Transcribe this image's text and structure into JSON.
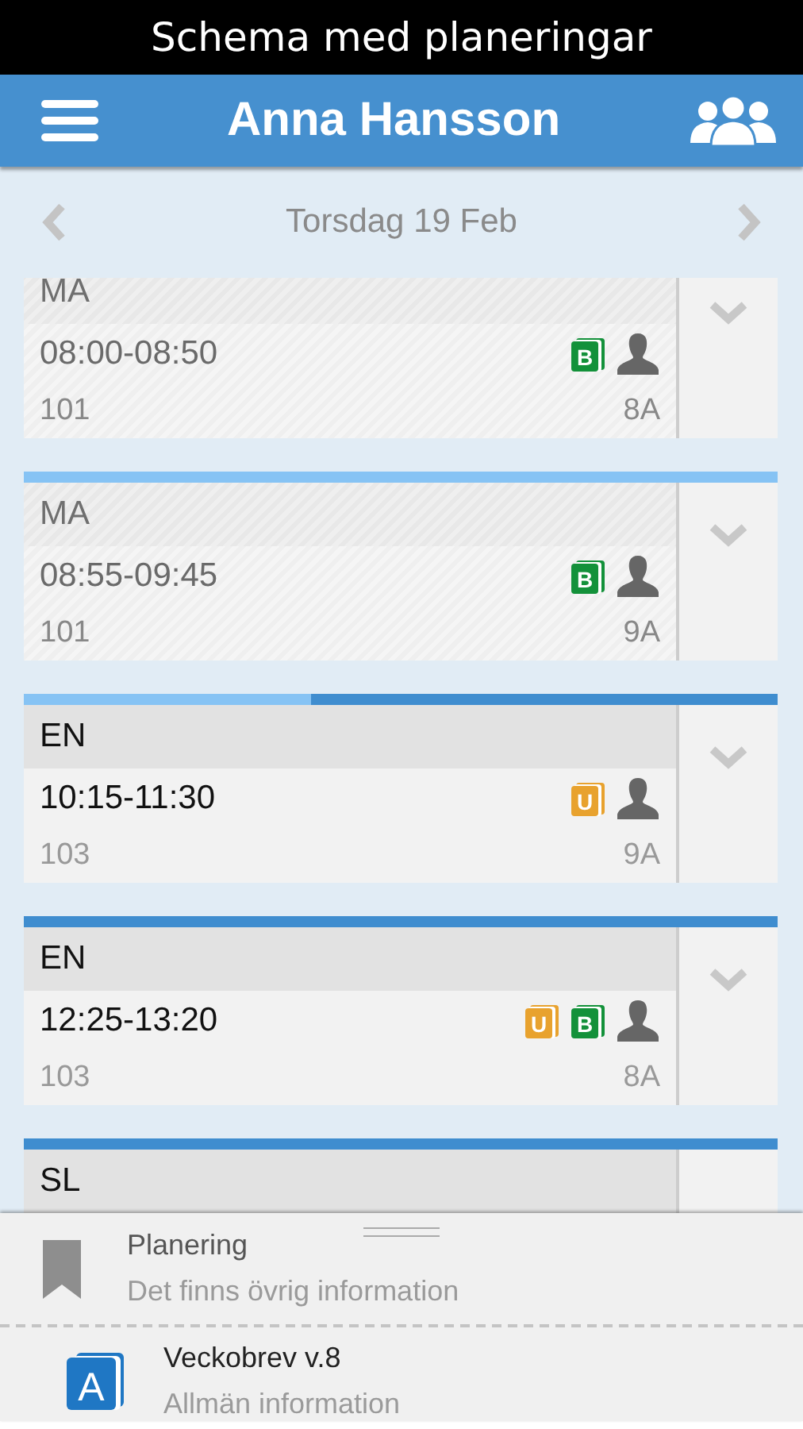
{
  "caption": "Schema med planeringar",
  "header": {
    "title": "Anna Hansson"
  },
  "date_nav": {
    "label": "Torsdag 19 Feb"
  },
  "lessons": [
    {
      "subject": "MA",
      "time": "08:00-08:50",
      "room": "101",
      "group": "8A",
      "past": true,
      "badges": [
        {
          "letter": "B",
          "color": "#13913a"
        }
      ]
    },
    {
      "subject": "MA",
      "time": "08:55-09:45",
      "room": "101",
      "group": "9A",
      "past": true,
      "level": 1,
      "badges": [
        {
          "letter": "B",
          "color": "#13913a"
        }
      ]
    },
    {
      "subject": "EN",
      "time": "10:15-11:30",
      "room": "103",
      "group": "9A",
      "past": false,
      "level": 0.38,
      "badges": [
        {
          "letter": "U",
          "color": "#e8a22e"
        }
      ]
    },
    {
      "subject": "EN",
      "time": "12:25-13:20",
      "room": "103",
      "group": "8A",
      "past": false,
      "badges": [
        {
          "letter": "U",
          "color": "#e8a22e"
        },
        {
          "letter": "B",
          "color": "#13913a"
        }
      ]
    },
    {
      "subject": "SL",
      "past": false
    }
  ],
  "drawer": {
    "items": [
      {
        "kind": "bookmark",
        "title": "Planering",
        "subtitle": "Det finns övrig information"
      },
      {
        "kind": "letter",
        "icon_letter": "A",
        "title": "Veckobrev v.8",
        "subtitle": "Allmän information"
      }
    ]
  }
}
